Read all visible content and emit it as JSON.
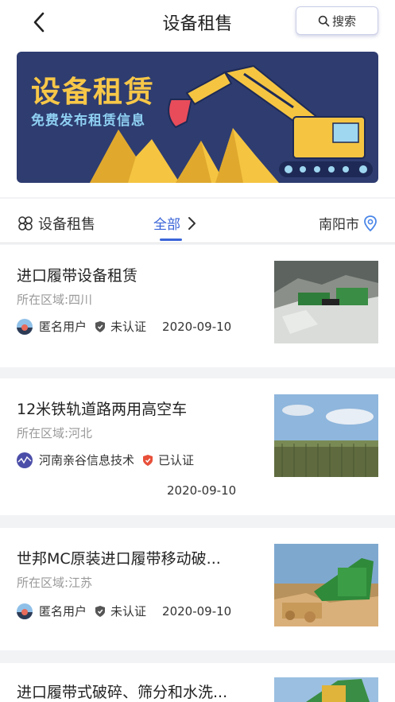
{
  "header": {
    "title": "设备租售",
    "search_label": "搜索"
  },
  "banner": {
    "title": "设备租赁",
    "subtitle": "免费发布租赁信息"
  },
  "filter": {
    "category_label": "设备租售",
    "all_label": "全部",
    "city_label": "南阳市"
  },
  "items": [
    {
      "title": "进口履带设备租赁",
      "region": "所在区域:四川",
      "user": "匿名用户",
      "cert": "未认证",
      "certified": false,
      "date": "2020-09-10"
    },
    {
      "title": "12米铁轨道路两用高空车",
      "region": "所在区域:河北",
      "user": "河南亲谷信息技术",
      "cert": "已认证",
      "certified": true,
      "date": "2020-09-10"
    },
    {
      "title": "世邦MC原装进口履带移动破...",
      "region": "所在区域:江苏",
      "user": "匿名用户",
      "cert": "未认证",
      "certified": false,
      "date": "2020-09-10"
    },
    {
      "title": "进口履带式破碎、筛分和水洗..."
    }
  ],
  "colors": {
    "accent": "#3a64d8",
    "banner_bg": "#2e3c70",
    "banner_title": "#f7c748",
    "certified": "#e8503a",
    "uncertified": "#555555"
  }
}
